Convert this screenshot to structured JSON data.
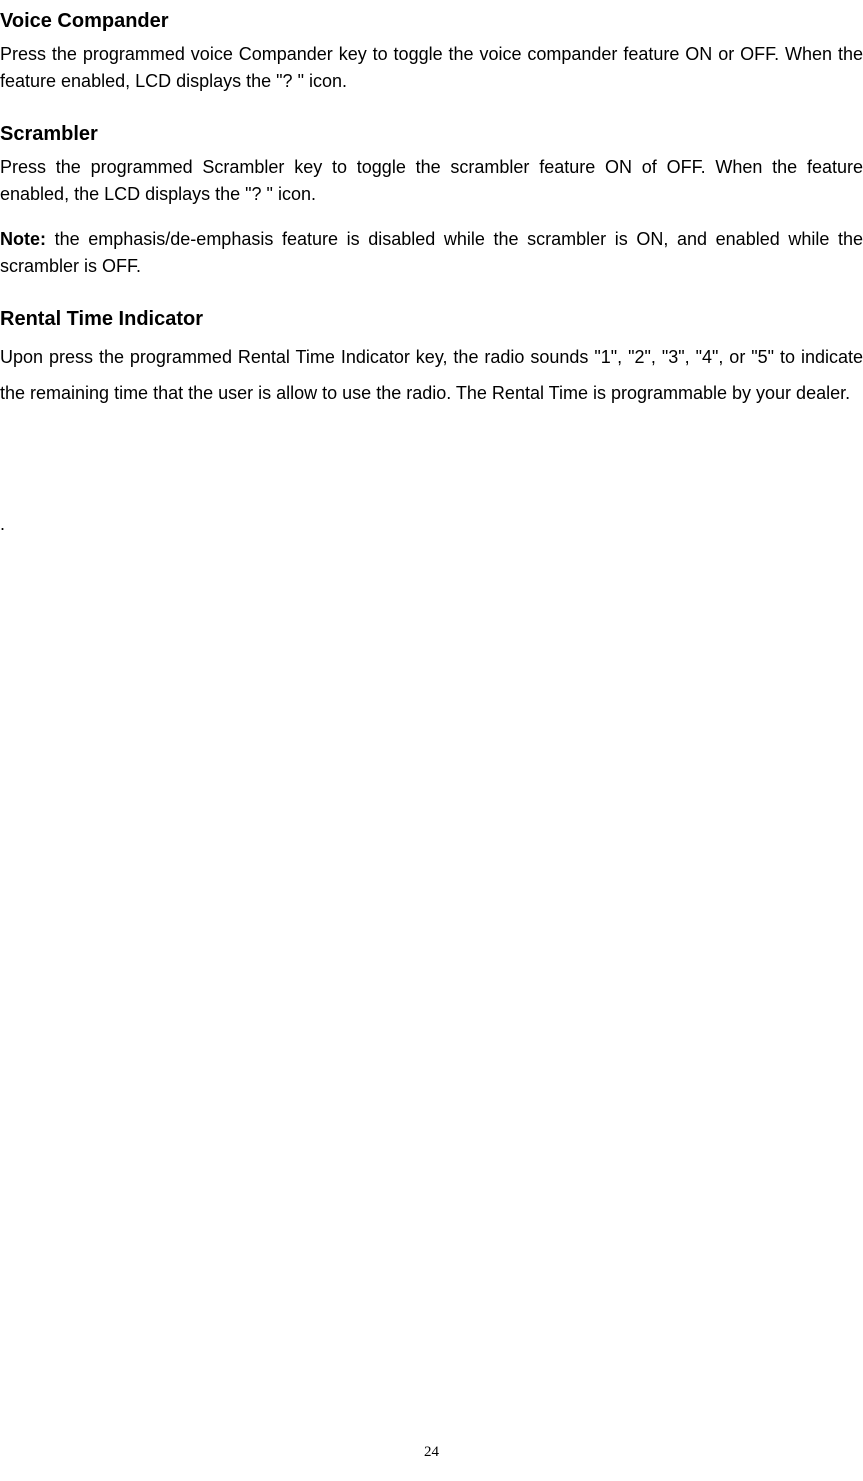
{
  "sections": {
    "voice_compander": {
      "heading": "Voice Compander",
      "body": "Press the programmed voice Compander key to toggle the voice compander feature ON or OFF. When the feature enabled, LCD displays the \"? \" icon."
    },
    "scrambler": {
      "heading": "Scrambler",
      "body": "Press the programmed Scrambler key to toggle the scrambler feature ON of OFF. When the feature enabled, the LCD displays the \"? \" icon.",
      "note_label": "Note:",
      "note_body": " the emphasis/de-emphasis feature is disabled while the scrambler is ON, and enabled while the scrambler is OFF."
    },
    "rental": {
      "heading": "Rental Time Indicator",
      "body": "Upon press the programmed Rental Time Indicator key, the radio sounds \"1\", \"2\", \"3\", \"4\", or \"5\" to indicate the remaining time that the user is allow to use the radio. The Rental Time is programmable by your dealer."
    }
  },
  "dot": ".",
  "page_number": "24"
}
